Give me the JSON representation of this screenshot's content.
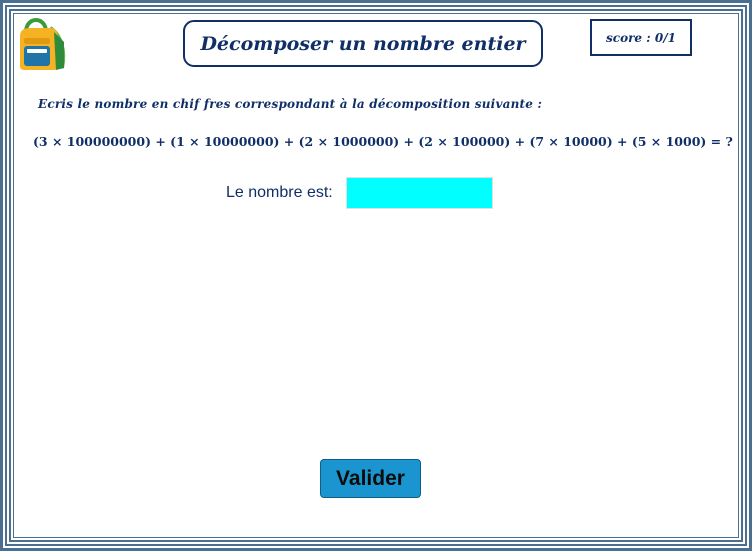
{
  "header": {
    "title": "Décomposer un nombre entier",
    "score": "score : 0/1",
    "logo_icon": "backpack-icon"
  },
  "exercise": {
    "instruction": "Ecris le nombre en chif fres correspondant à la décomposition suivante :",
    "equation": "(3 × 100000000) + (1 × 10000000) + (2 × 1000000) + (2 × 100000) + (7 × 10000) + (5 × 1000) = ?",
    "answer_label": "Le nombre est:",
    "answer_value": "",
    "answer_placeholder": ""
  },
  "actions": {
    "validate_label": "Valider"
  },
  "colors": {
    "frame": "#4a6f90",
    "text": "#0f2f66",
    "input_bg": "#00ffff",
    "button_bg": "#1a95cf"
  }
}
